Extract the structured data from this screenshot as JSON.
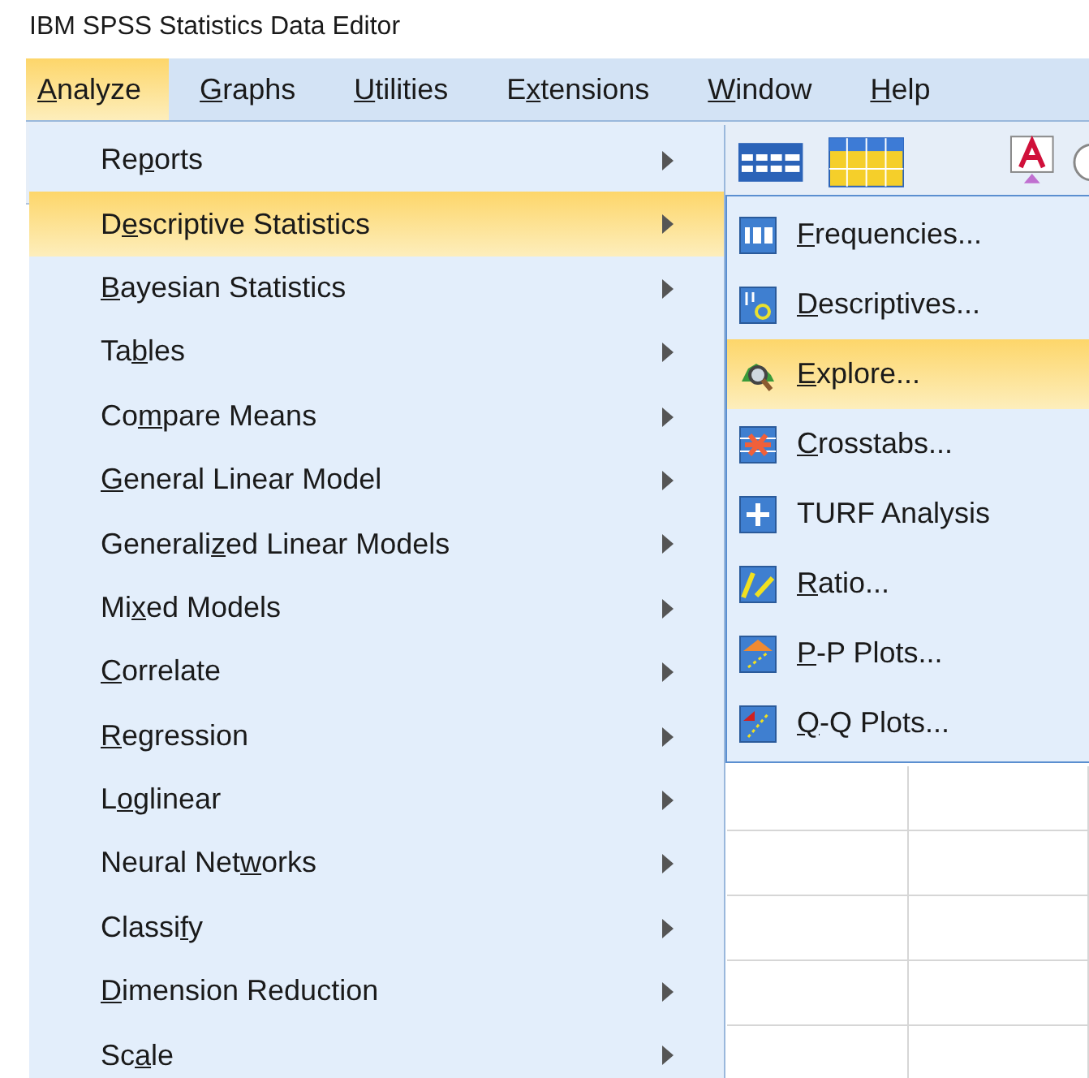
{
  "window": {
    "title": "IBM SPSS Statistics Data Editor"
  },
  "menubar": [
    {
      "key": "A",
      "post": "nalyze",
      "selected": true
    },
    {
      "key": "G",
      "post": "raphs",
      "selected": false
    },
    {
      "key": "U",
      "post": "tilities",
      "selected": false
    },
    {
      "pre": "E",
      "key": "x",
      "post": "tensions",
      "selected": false
    },
    {
      "key": "W",
      "post": "indow",
      "selected": false
    },
    {
      "key": "H",
      "post": "elp",
      "selected": false
    }
  ],
  "analyze_menu": [
    {
      "pre": "Re",
      "key": "p",
      "post": "orts",
      "selected": false
    },
    {
      "pre": "D",
      "key": "e",
      "post": "scriptive Statistics",
      "selected": true
    },
    {
      "key": "B",
      "post": "ayesian Statistics",
      "selected": false
    },
    {
      "pre": "Ta",
      "key": "b",
      "post": "les",
      "selected": false
    },
    {
      "pre": "Co",
      "key": "m",
      "post": "pare Means",
      "selected": false
    },
    {
      "key": "G",
      "post": "eneral Linear Model",
      "selected": false
    },
    {
      "pre": "Generali",
      "key": "z",
      "post": "ed Linear Models",
      "selected": false
    },
    {
      "pre": "Mi",
      "key": "x",
      "post": "ed Models",
      "selected": false
    },
    {
      "key": "C",
      "post": "orrelate",
      "selected": false
    },
    {
      "key": "R",
      "post": "egression",
      "selected": false
    },
    {
      "pre": "L",
      "key": "o",
      "post": "glinear",
      "selected": false
    },
    {
      "pre": "Neural Net",
      "key": "w",
      "post": "orks",
      "selected": false
    },
    {
      "pre": "Classi",
      "key": "f",
      "post": "y",
      "selected": false
    },
    {
      "key": "D",
      "post": "imension Reduction",
      "selected": false
    },
    {
      "pre": "Sc",
      "key": "a",
      "post": "le",
      "selected": false
    }
  ],
  "descriptive_statistics_submenu": [
    {
      "key": "F",
      "post": "requencies...",
      "selected": false
    },
    {
      "key": "D",
      "post": "escriptives...",
      "selected": false
    },
    {
      "key": "E",
      "post": "xplore...",
      "selected": true
    },
    {
      "key": "C",
      "post": "rosstabs...",
      "selected": false
    },
    {
      "pre": "TURF Analysis",
      "selected": false
    },
    {
      "key": "R",
      "post": "atio...",
      "selected": false
    },
    {
      "key": "P",
      "post": "-P Plots...",
      "selected": false
    },
    {
      "key": "Q",
      "post": "-Q Plots...",
      "selected": false
    }
  ]
}
